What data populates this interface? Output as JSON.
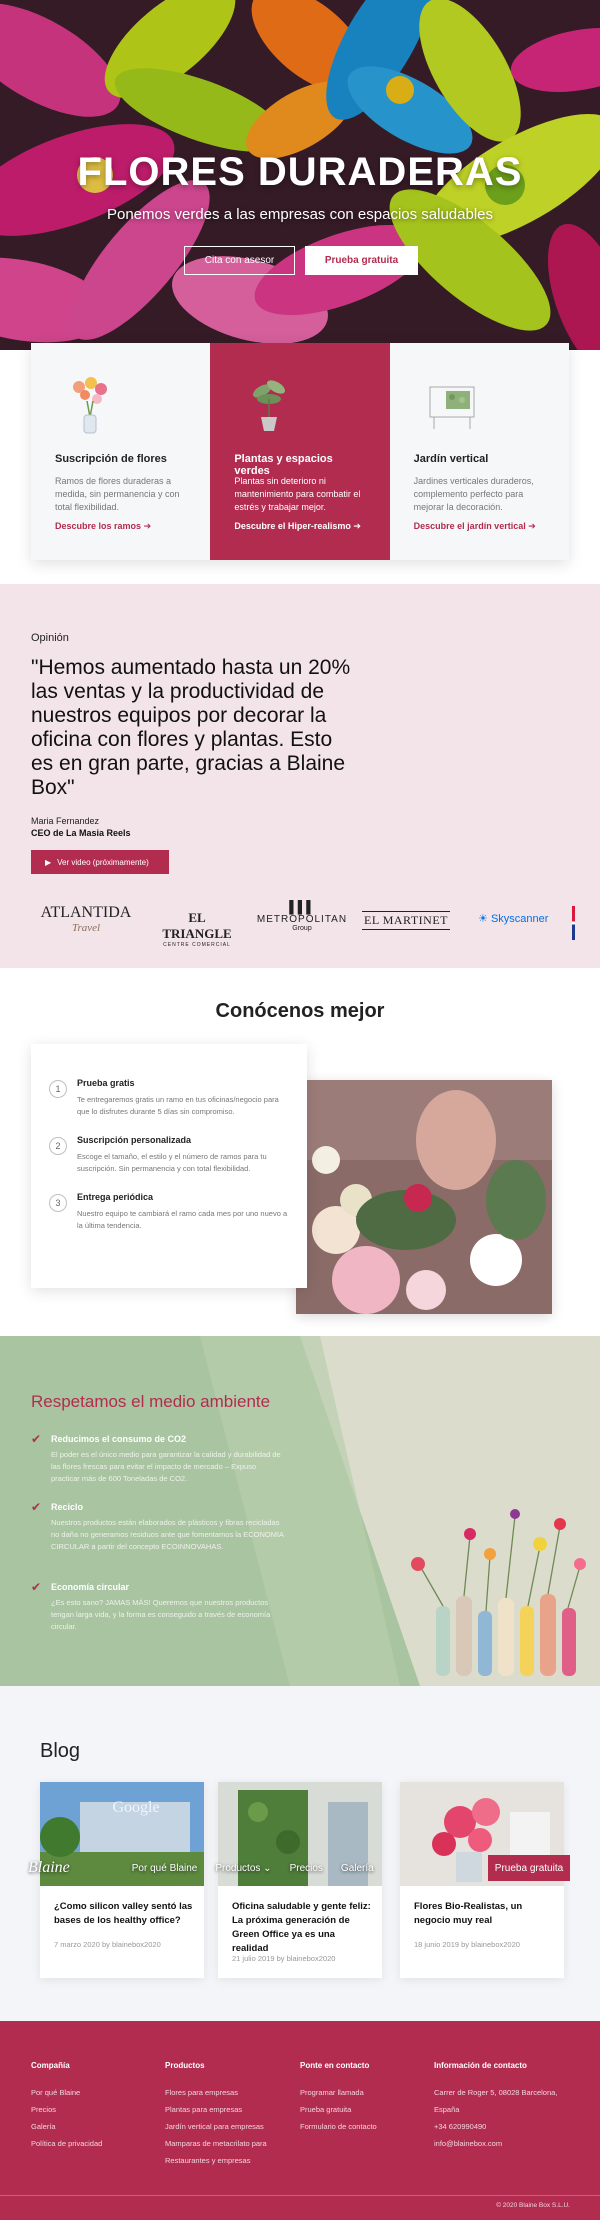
{
  "hero": {
    "title": "FLORES DURADERAS",
    "subtitle": "Ponemos verdes a las empresas con espacios saludables",
    "button_advisor": "Cita con asesor",
    "button_trial": "Prueba gratuita"
  },
  "cards": [
    {
      "title": "Suscripción de flores",
      "text": "Ramos de flores duraderas a medida, sin permanencia y con total flexibilidad.",
      "link": "Descubre los ramos"
    },
    {
      "title": "Plantas y espacios verdes",
      "text": "Plantas sin deterioro ni mantenimiento para combatir el estrés y trabajar mejor.",
      "link": "Descubre el Hiper-realismo"
    },
    {
      "title": "Jardín vertical",
      "text": "Jardines verticales duraderos, complemento perfecto para mejorar la decoración.",
      "link": "Descubre el jardín vertical"
    }
  ],
  "testimonial": {
    "label": "Opinión",
    "quote": "\"Hemos aumentado hasta un 20% las ventas y la productividad de nuestros equipos por decorar la oficina con flores y plantas. Esto es en gran parte, gracias a Blaine Box\"",
    "author": "Maria Fernandez",
    "role": "CEO de La Masia Reels",
    "video_button": "Ver video (próximamente)"
  },
  "logos": {
    "atlantida": "ATLANTIDA",
    "atlantida_sub": "Travel",
    "eltriangle": "EL TRIANGLE",
    "eltriangle_sub": "CENTRE COMERCIAL",
    "metropolitan": "METROPOLITAN",
    "metropolitan_sub": "Group",
    "martinet": "EL MARTINET",
    "skyscanner": "Skyscanner"
  },
  "about": {
    "title": "Conócenos mejor",
    "steps": [
      {
        "num": "1",
        "title": "Prueba gratis",
        "text": "Te entregaremos gratis un ramo en tus oficinas/negocio para que lo disfrutes durante 5 días sin compromiso."
      },
      {
        "num": "2",
        "title": "Suscripción personalizada",
        "text": "Escoge el tamaño, el estilo y el número de ramos para tu suscripción. Sin permanencia y con total flexibilidad."
      },
      {
        "num": "3",
        "title": "Entrega periódica",
        "text": "Nuestro equipo te cambiará el ramo cada mes por uno nuevo a la última tendencia."
      }
    ]
  },
  "environment": {
    "title": "Respetamos el medio ambiente",
    "items": [
      {
        "title": "Reducimos el consumo de CO2",
        "text": "El poder es el único medio para garantizar la calidad y durabilidad de las flores frescas para evitar el impacto de mercado – Expuso practicar más de 600 Toneladas de CO2."
      },
      {
        "title": "Reciclo",
        "text": "Nuestros productos están elaborados de plásticos y fibras recicladas no daña no generamos residuos ante que fomentamos la ECONOMIA CIRCULAR a partir del concepto ECOINNOVAHAS."
      },
      {
        "title": "Economía circular",
        "text": "¿Es esto sano? JAMAS MÁS! Queremos que nuestros productos tengan larga vida, y la forma es conseguido a través de economía circular."
      }
    ]
  },
  "blog": {
    "title": "Blog",
    "posts": [
      {
        "title": "¿Como silicon valley sentó las bases de los healthy office?",
        "meta": "7 marzo 2020 by blainebox2020",
        "img_text": "Google"
      },
      {
        "title": "Oficina saludable y gente feliz: La próxima generación de Green Office ya es una realidad",
        "meta": "21 julio 2019 by blainebox2020"
      },
      {
        "title": "Flores Bio-Realistas, un negocio muy real",
        "meta": "18 junio 2019 by blainebox2020"
      }
    ]
  },
  "navbar": {
    "logo": "Blaine",
    "items": [
      "Por qué Blaine",
      "Productos ⌄",
      "Precios",
      "Galería"
    ],
    "cta": "Prueba gratuita"
  },
  "footer": {
    "columns": [
      {
        "title": "Compañía",
        "links": [
          "Por qué Blaine",
          "Precios",
          "Galería",
          "Política de privacidad"
        ]
      },
      {
        "title": "Productos",
        "links": [
          "Flores para empresas",
          "Plantas para empresas",
          "Jardín vertical para empresas",
          "Mamparas de metacrilato para",
          "Restaurantes y empresas"
        ]
      },
      {
        "title": "Ponte en contacto",
        "links": [
          "Programar llamada",
          "Prueba gratuita",
          "Formulario de contacto"
        ]
      },
      {
        "title": "Información de contacto",
        "links": [
          "Carrer de Roger 5, 08028 Barcelona,",
          "España",
          "+34 620990490",
          "info@blainebox.com"
        ]
      }
    ],
    "copyright": "© 2020 Blaine Box S.L.U."
  },
  "colors": {
    "accent": "#b22c4f",
    "testimonial_bg": "#f2e4e9",
    "environment_green": "#a9c4a0",
    "blog_bg": "#f3f5f8"
  }
}
